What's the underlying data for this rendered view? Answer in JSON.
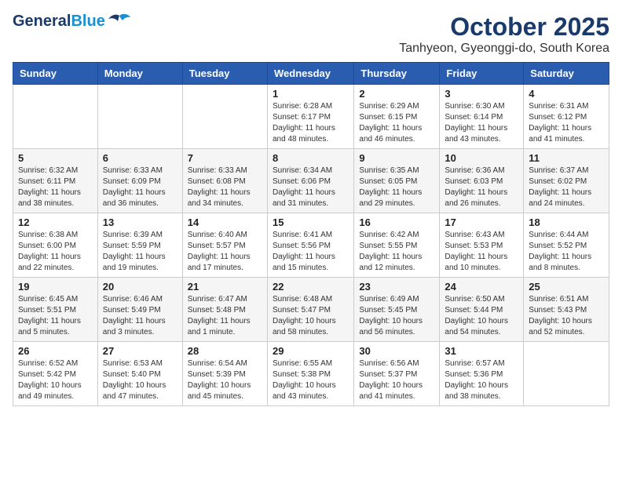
{
  "header": {
    "logo_line1": "General",
    "logo_line2": "Blue",
    "month": "October 2025",
    "location": "Tanhyeon, Gyeonggi-do, South Korea"
  },
  "weekdays": [
    "Sunday",
    "Monday",
    "Tuesday",
    "Wednesday",
    "Thursday",
    "Friday",
    "Saturday"
  ],
  "weeks": [
    [
      {
        "day": "",
        "info": ""
      },
      {
        "day": "",
        "info": ""
      },
      {
        "day": "",
        "info": ""
      },
      {
        "day": "1",
        "info": "Sunrise: 6:28 AM\nSunset: 6:17 PM\nDaylight: 11 hours\nand 48 minutes."
      },
      {
        "day": "2",
        "info": "Sunrise: 6:29 AM\nSunset: 6:15 PM\nDaylight: 11 hours\nand 46 minutes."
      },
      {
        "day": "3",
        "info": "Sunrise: 6:30 AM\nSunset: 6:14 PM\nDaylight: 11 hours\nand 43 minutes."
      },
      {
        "day": "4",
        "info": "Sunrise: 6:31 AM\nSunset: 6:12 PM\nDaylight: 11 hours\nand 41 minutes."
      }
    ],
    [
      {
        "day": "5",
        "info": "Sunrise: 6:32 AM\nSunset: 6:11 PM\nDaylight: 11 hours\nand 38 minutes."
      },
      {
        "day": "6",
        "info": "Sunrise: 6:33 AM\nSunset: 6:09 PM\nDaylight: 11 hours\nand 36 minutes."
      },
      {
        "day": "7",
        "info": "Sunrise: 6:33 AM\nSunset: 6:08 PM\nDaylight: 11 hours\nand 34 minutes."
      },
      {
        "day": "8",
        "info": "Sunrise: 6:34 AM\nSunset: 6:06 PM\nDaylight: 11 hours\nand 31 minutes."
      },
      {
        "day": "9",
        "info": "Sunrise: 6:35 AM\nSunset: 6:05 PM\nDaylight: 11 hours\nand 29 minutes."
      },
      {
        "day": "10",
        "info": "Sunrise: 6:36 AM\nSunset: 6:03 PM\nDaylight: 11 hours\nand 26 minutes."
      },
      {
        "day": "11",
        "info": "Sunrise: 6:37 AM\nSunset: 6:02 PM\nDaylight: 11 hours\nand 24 minutes."
      }
    ],
    [
      {
        "day": "12",
        "info": "Sunrise: 6:38 AM\nSunset: 6:00 PM\nDaylight: 11 hours\nand 22 minutes."
      },
      {
        "day": "13",
        "info": "Sunrise: 6:39 AM\nSunset: 5:59 PM\nDaylight: 11 hours\nand 19 minutes."
      },
      {
        "day": "14",
        "info": "Sunrise: 6:40 AM\nSunset: 5:57 PM\nDaylight: 11 hours\nand 17 minutes."
      },
      {
        "day": "15",
        "info": "Sunrise: 6:41 AM\nSunset: 5:56 PM\nDaylight: 11 hours\nand 15 minutes."
      },
      {
        "day": "16",
        "info": "Sunrise: 6:42 AM\nSunset: 5:55 PM\nDaylight: 11 hours\nand 12 minutes."
      },
      {
        "day": "17",
        "info": "Sunrise: 6:43 AM\nSunset: 5:53 PM\nDaylight: 11 hours\nand 10 minutes."
      },
      {
        "day": "18",
        "info": "Sunrise: 6:44 AM\nSunset: 5:52 PM\nDaylight: 11 hours\nand 8 minutes."
      }
    ],
    [
      {
        "day": "19",
        "info": "Sunrise: 6:45 AM\nSunset: 5:51 PM\nDaylight: 11 hours\nand 5 minutes."
      },
      {
        "day": "20",
        "info": "Sunrise: 6:46 AM\nSunset: 5:49 PM\nDaylight: 11 hours\nand 3 minutes."
      },
      {
        "day": "21",
        "info": "Sunrise: 6:47 AM\nSunset: 5:48 PM\nDaylight: 11 hours\nand 1 minute."
      },
      {
        "day": "22",
        "info": "Sunrise: 6:48 AM\nSunset: 5:47 PM\nDaylight: 10 hours\nand 58 minutes."
      },
      {
        "day": "23",
        "info": "Sunrise: 6:49 AM\nSunset: 5:45 PM\nDaylight: 10 hours\nand 56 minutes."
      },
      {
        "day": "24",
        "info": "Sunrise: 6:50 AM\nSunset: 5:44 PM\nDaylight: 10 hours\nand 54 minutes."
      },
      {
        "day": "25",
        "info": "Sunrise: 6:51 AM\nSunset: 5:43 PM\nDaylight: 10 hours\nand 52 minutes."
      }
    ],
    [
      {
        "day": "26",
        "info": "Sunrise: 6:52 AM\nSunset: 5:42 PM\nDaylight: 10 hours\nand 49 minutes."
      },
      {
        "day": "27",
        "info": "Sunrise: 6:53 AM\nSunset: 5:40 PM\nDaylight: 10 hours\nand 47 minutes."
      },
      {
        "day": "28",
        "info": "Sunrise: 6:54 AM\nSunset: 5:39 PM\nDaylight: 10 hours\nand 45 minutes."
      },
      {
        "day": "29",
        "info": "Sunrise: 6:55 AM\nSunset: 5:38 PM\nDaylight: 10 hours\nand 43 minutes."
      },
      {
        "day": "30",
        "info": "Sunrise: 6:56 AM\nSunset: 5:37 PM\nDaylight: 10 hours\nand 41 minutes."
      },
      {
        "day": "31",
        "info": "Sunrise: 6:57 AM\nSunset: 5:36 PM\nDaylight: 10 hours\nand 38 minutes."
      },
      {
        "day": "",
        "info": ""
      }
    ]
  ]
}
